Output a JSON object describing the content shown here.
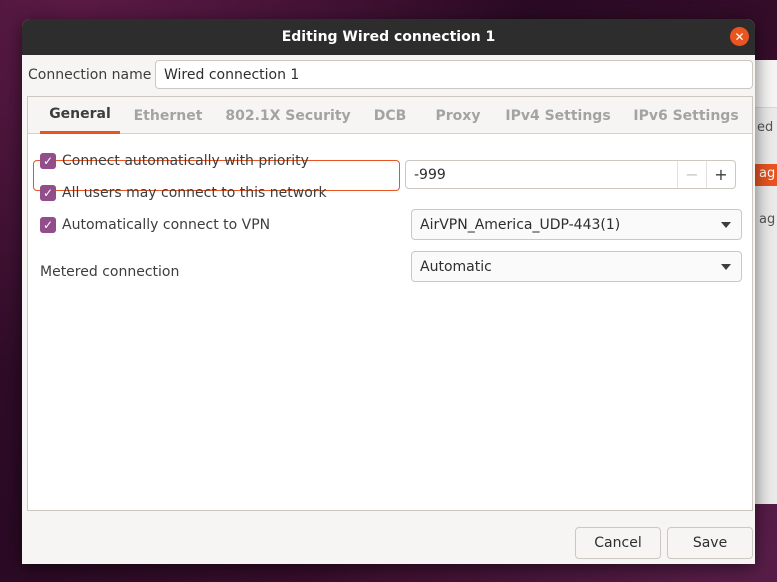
{
  "background_window": {
    "text1": "ed",
    "badge": "ag",
    "text2": "ag"
  },
  "dialog": {
    "title": "Editing Wired connection 1",
    "close_icon": "close-icon",
    "connection_name_label": "Connection name",
    "connection_name_value": "Wired connection 1",
    "tabs": [
      {
        "label": "General",
        "active": true
      },
      {
        "label": "Ethernet",
        "active": false
      },
      {
        "label": "802.1X Security",
        "active": false
      },
      {
        "label": "DCB",
        "active": false
      },
      {
        "label": "Proxy",
        "active": false
      },
      {
        "label": "IPv4 Settings",
        "active": false
      },
      {
        "label": "IPv6 Settings",
        "active": false
      }
    ],
    "general": {
      "auto_connect_label": "Connect automatically with priority",
      "auto_connect_checked": true,
      "priority_value": "-999",
      "minus": "−",
      "plus": "+",
      "all_users_label": "All users may connect to this network",
      "all_users_checked": true,
      "auto_vpn_label": "Automatically connect to VPN",
      "auto_vpn_checked": true,
      "vpn_selected": "AirVPN_America_UDP-443(1)",
      "metered_label": "Metered connection",
      "metered_selected": "Automatic"
    },
    "buttons": {
      "cancel": "Cancel",
      "save": "Save"
    }
  },
  "colors": {
    "accent": "#e95420",
    "checkbox": "#924d8b",
    "titlebar": "#2d2d2d"
  }
}
